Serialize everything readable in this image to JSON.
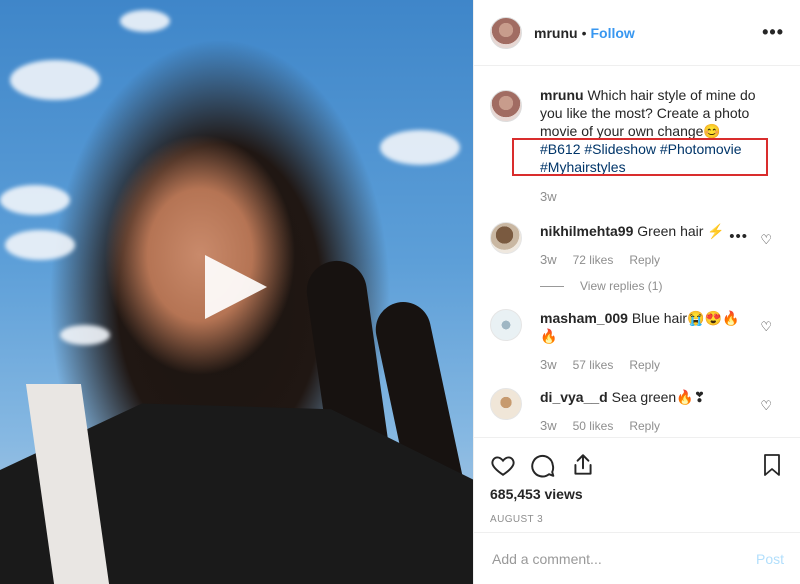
{
  "author": {
    "username": "mrunu",
    "separator": "•",
    "follow_label": "Follow",
    "more_label": "•••"
  },
  "caption": {
    "username": "mrunu",
    "text": "Which hair style of mine do you like the most? Create a photo movie of your own change😊",
    "hashtags": "#B612 #Slideshow #Photomovie #Myhairstyles",
    "age": "3w",
    "highlight_color": "#d92d2d"
  },
  "comments": [
    {
      "username": "nikhilmehta99",
      "text": "Green hair ⚡",
      "age": "3w",
      "likes": "72 likes",
      "reply_label": "Reply",
      "view_replies": "View replies (1)",
      "more_label": "•••"
    },
    {
      "username": "masham_009",
      "text": "Blue hair😭😍🔥🔥",
      "age": "3w",
      "likes": "57 likes",
      "reply_label": "Reply"
    },
    {
      "username": "di_vya__d",
      "text": "Sea green🔥❣",
      "age": "3w",
      "likes": "50 likes",
      "reply_label": "Reply"
    }
  ],
  "stats": {
    "views": "685,453 views",
    "date": "AUGUST 3"
  },
  "add_comment": {
    "placeholder": "Add a comment...",
    "post_label": "Post"
  },
  "icons": [
    "play-icon",
    "more-icon",
    "heart-icon",
    "comment-icon",
    "share-icon",
    "bookmark-icon"
  ],
  "colors": {
    "link": "#3897f0",
    "hashtag": "#003569",
    "muted": "#8e8e8e",
    "post_disabled": "#b2dffc"
  }
}
